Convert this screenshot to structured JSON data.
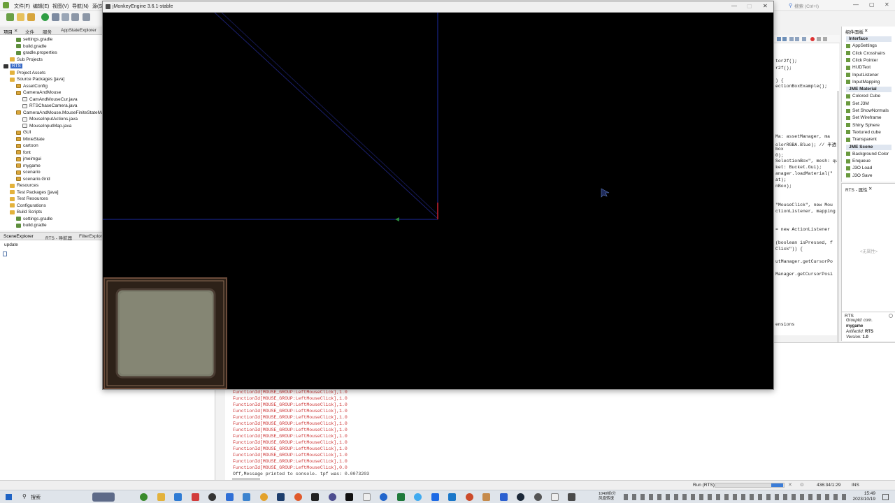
{
  "ide": {
    "menus": [
      "文件(F)",
      "编辑(E)",
      "视图(V)",
      "导航(N)",
      "源(S)"
    ],
    "search_placeholder": "搜索 (Ctrl+I)",
    "left_tabs": [
      "项目",
      "文件",
      "服务",
      "AppStateExplorer"
    ],
    "tree": [
      {
        "label": "settings.gradle",
        "icon": "gradle-file-icon",
        "indent": 3
      },
      {
        "label": "build.gradle",
        "icon": "gradle-file-icon",
        "indent": 3
      },
      {
        "label": "gradle.properties",
        "icon": "properties-file-icon",
        "indent": 3
      },
      {
        "label": "Sub Projects",
        "icon": "folder-icon",
        "indent": 2
      },
      {
        "label": "RTS",
        "icon": "project-icon",
        "indent": 1,
        "selected": true
      },
      {
        "label": "Project Assets",
        "icon": "folder-icon",
        "indent": 2
      },
      {
        "label": "Source Packages [java]",
        "icon": "folder-icon",
        "indent": 2
      },
      {
        "label": "AssetConfig",
        "icon": "package-icon",
        "indent": 3
      },
      {
        "label": "CameraAndMouse",
        "icon": "package-icon",
        "indent": 3
      },
      {
        "label": "CamAndMouseCur.java",
        "icon": "java-file-icon",
        "indent": 4
      },
      {
        "label": "RTSChaseCamera.java",
        "icon": "java-file-icon",
        "indent": 4
      },
      {
        "label": "CameraAndMouse.MouseFiniteStateMachine",
        "icon": "package-icon",
        "indent": 3
      },
      {
        "label": "MouseInputActions.java",
        "icon": "java-file-icon",
        "indent": 4
      },
      {
        "label": "MouseInputMap.java",
        "icon": "java-file-icon",
        "indent": 4
      },
      {
        "label": "GUI",
        "icon": "package-icon",
        "indent": 3
      },
      {
        "label": "MinieState",
        "icon": "package-icon",
        "indent": 3
      },
      {
        "label": "cartoon",
        "icon": "package-icon",
        "indent": 3
      },
      {
        "label": "font",
        "icon": "package-icon",
        "indent": 3
      },
      {
        "label": "jmeimgui",
        "icon": "package-icon",
        "indent": 3
      },
      {
        "label": "mygame",
        "icon": "package-icon",
        "indent": 3
      },
      {
        "label": "scenario",
        "icon": "package-icon",
        "indent": 3
      },
      {
        "label": "scenario.Grid",
        "icon": "package-icon",
        "indent": 3
      },
      {
        "label": "Resources",
        "icon": "folder-icon",
        "indent": 2
      },
      {
        "label": "Test Packages [java]",
        "icon": "folder-icon",
        "indent": 2
      },
      {
        "label": "Test Resources",
        "icon": "folder-icon",
        "indent": 2
      },
      {
        "label": "Configurations",
        "icon": "config-icon",
        "indent": 2
      },
      {
        "label": "Build Scripts",
        "icon": "folder-icon",
        "indent": 2
      },
      {
        "label": "settings.gradle",
        "icon": "gradle-file-icon",
        "indent": 3
      },
      {
        "label": "build.gradle",
        "icon": "gradle-file-icon",
        "indent": 3
      }
    ],
    "scene_tabs": [
      "SceneExplorer",
      "RTS - 导航器",
      "FilterExplorer"
    ],
    "scene_label": "update",
    "code_lines": [
      {
        "text": "tor2f();",
        "cls": ""
      },
      {
        "text": "r2f();",
        "cls": ""
      },
      {
        "text": ") {",
        "cls": ""
      },
      {
        "text": "ectionBoxExample();",
        "cls": ""
      },
      {
        "text": "Ma: assetManager, ma",
        "cls": "str"
      },
      {
        "text": "olorRGBA.Blue); // 半透",
        "cls": ""
      },
      {
        "text": "  box",
        "cls": "cm"
      },
      {
        "text": " 0);",
        "cls": ""
      },
      {
        "text": "SelectionBox\", mesh: qu",
        "cls": "str"
      },
      {
        "text": "ket: Bucket.Gui);",
        "cls": ""
      },
      {
        "text": "anager.loadMaterial(\"",
        "cls": "cm"
      },
      {
        "text": "at);",
        "cls": ""
      },
      {
        "text": "nBox);",
        "cls": "str"
      },
      {
        "text": "\"MouseClick\", new Mou",
        "cls": "str"
      },
      {
        "text": "ctionListener, mapping",
        "cls": "str"
      },
      {
        "text": "= new ActionListener",
        "cls": "kw"
      },
      {
        "text": "(boolean isPressed, f",
        "cls": "kw"
      },
      {
        "text": "Click\")) {",
        "cls": "str"
      },
      {
        "text": "utManager.getCursorPo",
        "cls": "str"
      },
      {
        "text": "Manager.getCursorPosi",
        "cls": "str"
      },
      {
        "text": "ensions",
        "cls": "cm"
      }
    ],
    "palette": {
      "tab": "组件面板",
      "groups": [
        {
          "header": "Interface",
          "items": [
            "AppSettings",
            "Click Crosshairs",
            "Click Pointer",
            "HUDText",
            "InputListener",
            "InputMapping"
          ]
        },
        {
          "header": "JME Material",
          "items": [
            "Colored Cube",
            "Set J3M",
            "Set ShowNormals",
            "Set Wireframe",
            "Shiny Sphere",
            "Textured cube",
            "Transparent"
          ]
        },
        {
          "header": "JME Scene",
          "items": [
            "Background Color",
            "Enqueue",
            "J3O Load",
            "J3O Save"
          ]
        }
      ]
    },
    "props": {
      "tab": "RTS - 属性",
      "empty": "<无属性>",
      "info_title": "RTS",
      "group_label": "GroupId: com.",
      "group_value": "mygame",
      "artifact_label": "ArtifactId:",
      "artifact_value": "RTS",
      "version_label": "Version:",
      "version_value": "1.0"
    },
    "output_lines": [
      {
        "text": "FunctionId[MOUSE_GROUP:LeftMouseClick],1.0",
        "plain": false
      },
      {
        "text": "FunctionId[MOUSE_GROUP:LeftMouseClick],1.0",
        "plain": false
      },
      {
        "text": "FunctionId[MOUSE_GROUP:LeftMouseClick],1.0",
        "plain": false
      },
      {
        "text": "FunctionId[MOUSE_GROUP:LeftMouseClick],1.0",
        "plain": false
      },
      {
        "text": "FunctionId[MOUSE_GROUP:LeftMouseClick],1.0",
        "plain": false
      },
      {
        "text": "FunctionId[MOUSE_GROUP:LeftMouseClick],1.0",
        "plain": false
      },
      {
        "text": "FunctionId[MOUSE_GROUP:LeftMouseClick],1.0",
        "plain": false
      },
      {
        "text": "FunctionId[MOUSE_GROUP:LeftMouseClick],1.0",
        "plain": false
      },
      {
        "text": "FunctionId[MOUSE_GROUP:LeftMouseClick],1.0",
        "plain": false
      },
      {
        "text": "FunctionId[MOUSE_GROUP:LeftMouseClick],1.0",
        "plain": false
      },
      {
        "text": "FunctionId[MOUSE_GROUP:LeftMouseClick],1.0",
        "plain": false
      },
      {
        "text": "FunctionId[MOUSE_GROUP:LeftMouseClick],1.0",
        "plain": false
      },
      {
        "text": "FunctionId[MOUSE_GROUP:LeftMouseClick],0.0",
        "plain": false
      },
      {
        "text": "Off,Message printed to console.  tpf was: 0.0073203",
        "plain": true
      }
    ],
    "status": {
      "run_label": "Run (RTS)",
      "position": "436:34/1:29",
      "mode": "INS"
    }
  },
  "jme": {
    "title": "jMonkeyEngine 3.6.1-stable"
  },
  "taskbar": {
    "search_label": "搜索",
    "weather_line1": "1040帧/分",
    "weather_line2": "风扇转速",
    "time": "15:49",
    "date": "2023/10/19"
  }
}
